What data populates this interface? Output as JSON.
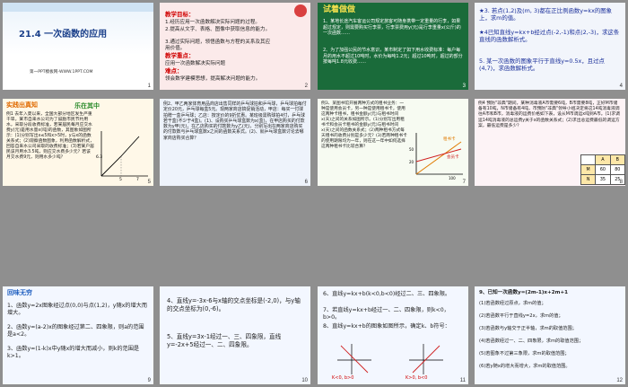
{
  "slides": [
    {
      "num": "1",
      "title": "21.4 一次函数的应用",
      "subtitle": "第一PPT模板网-WWW.1PPT.COM"
    },
    {
      "num": "2",
      "heading1": "教学目标：",
      "goals": [
        "1.经历应用一次函数解决实际问题的过程。",
        "2.提高从文字、表格、图像中获取信息的能力。",
        "3.通过实际问题，领悟函数与方程的关系及其应用价值。"
      ],
      "heading2": "教学重点：",
      "focus": "应用一次函数解决实际问题",
      "heading3": "难点：",
      "difficulty": "领会数学建模思想，提高解决问题的能力。"
    },
    {
      "num": "3",
      "badge": "试着做做",
      "q1": "1、某地长途汽车客运公司规定旅客可随身携带一定重量的行李，如果超过规定，则需要购买行李票，行李票费用y(元)是行李重量x(公斤)的一次函数……",
      "q2": "2、为了加强公民的节水意识，某市制定了如下用水收费标准：每户每月的用水不超过10吨时，水价为每吨1.2元；超过10吨时，超过的部分按每吨1.8元收费……"
    },
    {
      "num": "4",
      "q3": "★3. 若点(1,2)及(m, 3)都在正比例函数y=kx的图象上，求m的值。",
      "q4": "★4已知直线y=kx+b经过点(-2,-1)和点(2,-3)，求这条直线的函数解析式。",
      "q5": "5. 某一次函数的图象平行于直线y=0.5x，且过点(4,7)，求函数解析式。"
    },
    {
      "num": "5",
      "banner1": "实践出真知",
      "banner2": "乐在其中",
      "text": "例1  去年入夏以来，全国大部分地区发生严重干旱。某市自来水公司为了鼓励市民节约用水，采取分段收费标准，若某居民每月应交水费y(元)是用水量x(吨)的函数，其图象如图所示：(1)分别写出x≤5和x>5时，y与x的函数关系式；(2)观察函数图象，利用函数解析式，回答自来水公司采取的收费标准；(3)若某户居民该月用水3.5吨，则应交水费多少元？若该月交水费9元，则用水多少吨？",
      "yaxis": "y(元)",
      "xaxis": "x(吨)",
      "t1": "6.3",
      "t2": "5",
      "t3": "7"
    },
    {
      "num": "6",
      "text": "例2、甲乙两家体育用品商店出售同样的乒乓球拍和乒乓球，乒乓球拍每付定价20元，乒乓球每盒5元。现两家商店搞促销活动，甲店：每买一付球拍赠一盒乒乓球；乙店：按定价的9折优惠。某班级需购球拍4付，乒乓球若干盒(不少于4盒)。(1)、设购买乒乓球盒数为x(盒)，在甲店购买的付款数为y甲(元)，在乙店购买的付款数为y乙(元)，分别写出在两家商店购买的付款数与乒乓球盒数x之间的函数关系式。(2)、就乒乓球盒数讨论去哪家商店购买合算？"
    },
    {
      "num": "7",
      "text": "例3、某图书馆开展两种方式的租书业务：一种是使用会员卡，另一种是使用租书卡，使用这两种卡租书，租书金额y(元)与租书时间x(天)之间的关系如图所示。(1)分别写出用租书卡和会员卡租书的金额y(元)与租书时间x(天)之间的函数关系式；(2)两种租书方式每天租书的收费分别是多少元？(3)若两种租书卡的使用期限均为一年，则在这一年中如何选择这两种租书卡比较合算？",
      "l1": "租书卡",
      "l2": "会员卡",
      "v1": "50",
      "v2": "20",
      "v3": "100"
    },
    {
      "num": "8",
      "text": "例4  预防\"非典\"期间，某种消毒液A市需要6吨，B市需要8吨，正好M市储备有10吨，N市储备有4吨，市预防\"非典\"领导小组决定将这14吨消毒液调往A市和B市，消毒液的运费价格如下表，设从M市调运x吨到A市。(1)求调运14吨消毒液的总运费y关于x的函数关系式；(2)求出总运费最低的调运方案，最低运费是多少？",
      "th": [
        "",
        "A",
        "B"
      ],
      "r1": [
        "M",
        "60",
        "80"
      ],
      "r2": [
        "N",
        "35",
        "25"
      ]
    },
    {
      "num": "9",
      "badge": "回味无穷",
      "lines": [
        "1、函数y=2x图象经过点(0,0)与点(1,2)，y随x的增大而增大。",
        "2、函数y=(a-2)x的图象经过第二、四象限，则a的范围是a<2。",
        "3、函数y=(1-k)x中y随x的增大而减小，则k的范围是k>1。"
      ]
    },
    {
      "num": "10",
      "lines": [
        "4、直线y=-3x-6与x轴的交点坐标是(-2,0)，与y轴的交点坐标为(0,-6)。",
        "5、直线y=3x-1经过一、三、四象限，直线y=-2x+5经过一、二、四象限。"
      ]
    },
    {
      "num": "11",
      "lines": [
        "6、直线y=kx+b(k<0,b<0)经过二、三、四象限。",
        "7、若直线y=kx+b经过一、二、四象限，则k<0，b>0。",
        "8、直线y=kx+b的图象如图所示，确定k、b符号："
      ],
      "c1": "K<0, b>0",
      "c2": "K>0, b<0"
    },
    {
      "num": "12",
      "lines": [
        "9、已知一次函数y=(2m-1)x+2m+1",
        "(1)若函数经过原点，求m的值；",
        "(2)若函数平行于直线y=2x，求m的值；",
        "(3)若函数与y轴交于正半轴，求m的取值范围；",
        "(4)若函数经过一、二、四象限，求m的取值范围；",
        "(5)若图象不过第三象限，求m的取值范围；",
        "(6)若y随x的增大而增大，求m的取值范围。"
      ]
    }
  ]
}
